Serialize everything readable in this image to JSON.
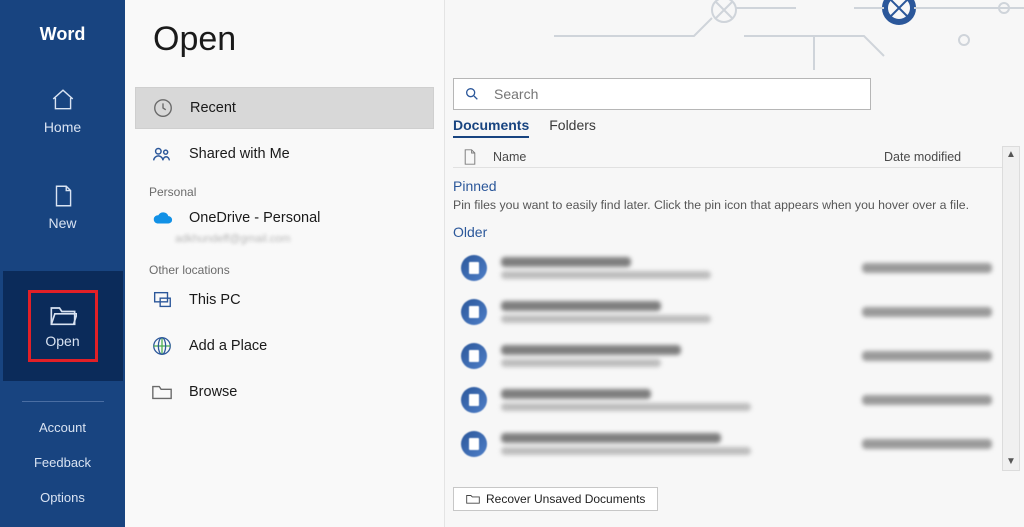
{
  "brand": "Word",
  "nav": {
    "home": "Home",
    "new": "New",
    "open": "Open",
    "account": "Account",
    "feedback": "Feedback",
    "options": "Options"
  },
  "page_title": "Open",
  "sources": {
    "recent": "Recent",
    "shared": "Shared with Me",
    "group_personal": "Personal",
    "onedrive": "OneDrive - Personal",
    "onedrive_sub": "adkhundeff@gmail.com",
    "group_other": "Other locations",
    "this_pc": "This PC",
    "add_place": "Add a Place",
    "browse": "Browse"
  },
  "search": {
    "placeholder": "Search"
  },
  "tabs": {
    "documents": "Documents",
    "folders": "Folders"
  },
  "columns": {
    "name": "Name",
    "date": "Date modified"
  },
  "pinned": {
    "label": "Pinned",
    "hint": "Pin files you want to easily find later. Click the pin icon that appears when you hover over a file."
  },
  "older": {
    "label": "Older"
  },
  "files": [
    {
      "name": "2. Hexagon Labels",
      "path": "Desktop » 101 Word Templates » Business",
      "date": "2/26/2022 1:10 AM"
    },
    {
      "name": "1. Restaurant Brochure",
      "path": "Desktop » 101 Word Templates » Business",
      "date": "2/25/2022 5:05 PM"
    },
    {
      "name": "101 Free Word Templates",
      "path": "Desktop » 101 Word Templates",
      "date": "2/25/2022 1:30 PM"
    },
    {
      "name": "101. Columns Resume",
      "path": "Desktop » 101 Word Templates » Resume & Cover L…",
      "date": "2/21/2022 2:44 PM"
    },
    {
      "name": "100. Modern Resume with QR code",
      "path": "Desktop » 101 Word Templates » Resume & Cover L…",
      "date": "2/21/2022 2:42 PM"
    }
  ],
  "recover": "Recover Unsaved Documents"
}
